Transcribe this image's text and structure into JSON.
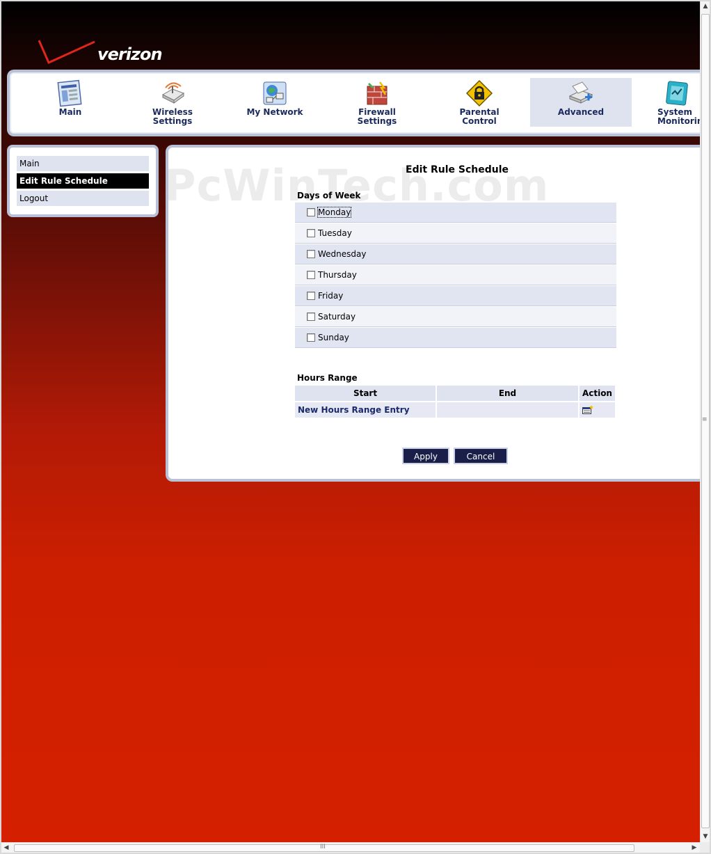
{
  "brand": {
    "name": "verizon",
    "colors": {
      "accent": "#d42000",
      "nav_text": "#1a2a5c",
      "button": "#1a1f4a",
      "row_odd": "#e1e5f2",
      "row_even": "#f1f3f9"
    }
  },
  "topnav": {
    "items": [
      {
        "label": "Main",
        "icon": "main-page-icon"
      },
      {
        "label": "Wireless\nSettings",
        "icon": "wireless-router-icon"
      },
      {
        "label": "My Network",
        "icon": "my-network-icon"
      },
      {
        "label": "Firewall\nSettings",
        "icon": "firewall-icon"
      },
      {
        "label": "Parental\nControl",
        "icon": "padlock-warning-icon"
      },
      {
        "label": "Advanced",
        "icon": "advanced-scanner-icon",
        "active": true
      },
      {
        "label": "System\nMonitorin",
        "icon": "system-monitor-icon"
      }
    ]
  },
  "sidemenu": {
    "items": [
      {
        "label": "Main"
      },
      {
        "label": "Edit Rule Schedule",
        "active": true
      },
      {
        "label": "Logout"
      }
    ]
  },
  "content": {
    "watermark": "PcWinTech.com",
    "title": "Edit Rule Schedule",
    "days_section_title": "Days of Week",
    "days": [
      {
        "label": "Monday",
        "checked": false,
        "focused": true
      },
      {
        "label": "Tuesday",
        "checked": false
      },
      {
        "label": "Wednesday",
        "checked": false
      },
      {
        "label": "Thursday",
        "checked": false
      },
      {
        "label": "Friday",
        "checked": false
      },
      {
        "label": "Saturday",
        "checked": false
      },
      {
        "label": "Sunday",
        "checked": false
      }
    ],
    "hours_section_title": "Hours Range",
    "hours_table": {
      "headers": {
        "start": "Start",
        "end": "End",
        "action": "Action"
      },
      "new_entry_label": "New Hours Range Entry",
      "new_entry_icon": "add-entry-icon"
    },
    "buttons": {
      "apply": "Apply",
      "cancel": "Cancel"
    }
  },
  "scrollbars": {
    "vertical_grip": "≡",
    "horizontal_grip": "III"
  }
}
